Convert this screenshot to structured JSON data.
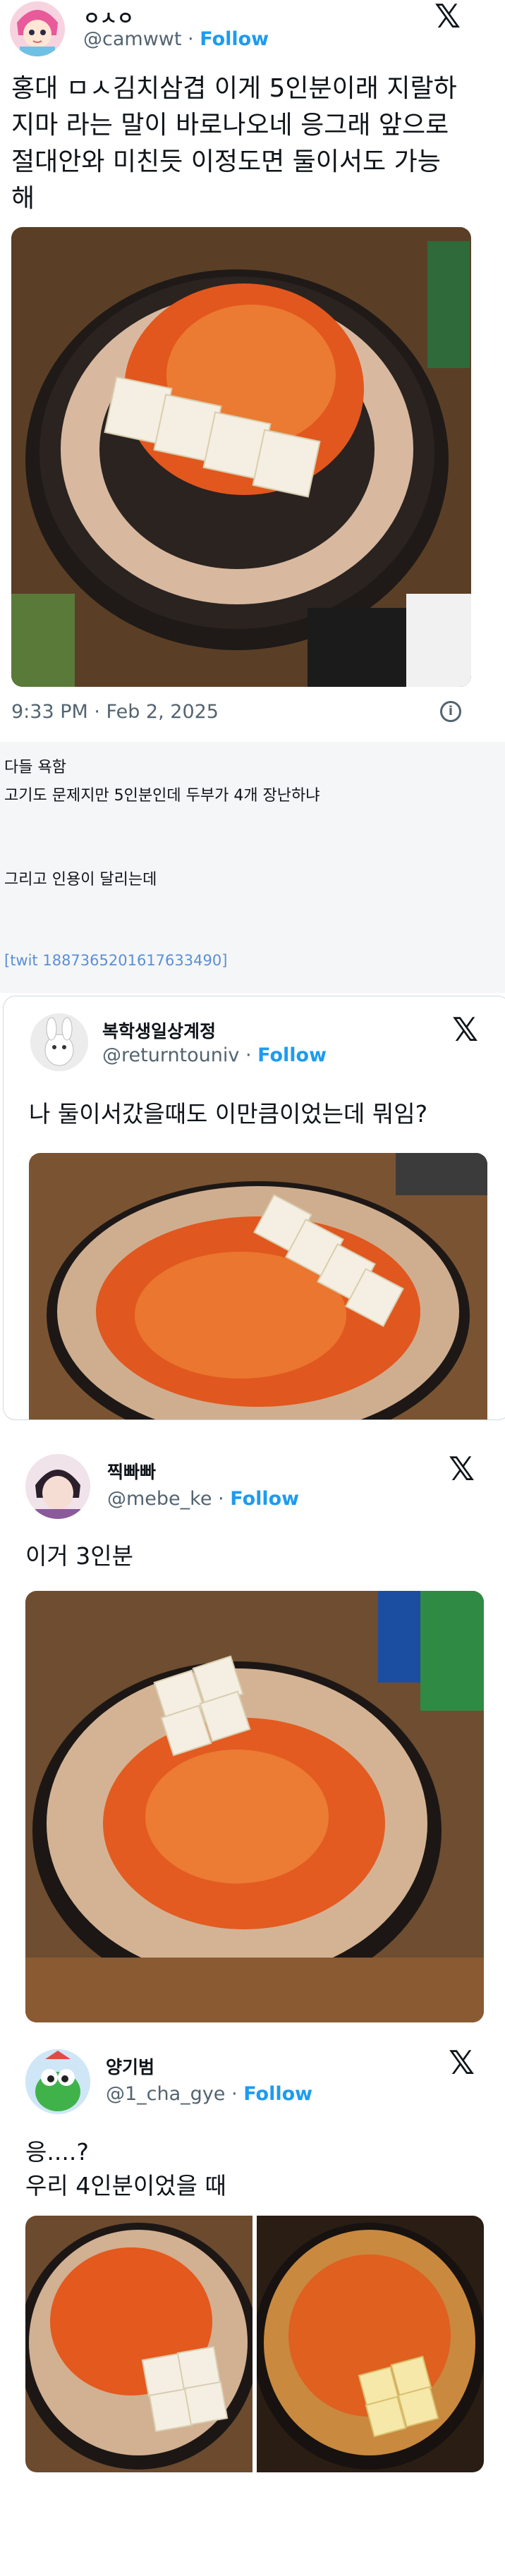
{
  "tweet1": {
    "name": "ㅇㅅㅇ",
    "handle": "@camwwt",
    "follow": "Follow",
    "text_lines": [
      "홍대 ㅁㅅ김치삼겹 이게 5인분이래 지랄하",
      "지마 라는 말이 바로나오네 응그래 앞으로",
      "절대안와 미친듯 이정도면 둘이서도 가능",
      "해"
    ],
    "time": "9:33 PM · Feb 2, 2025"
  },
  "post": {
    "lines": [
      "다들 욕함",
      "고기도 문제지만 5인분인데 두부가 4개 장난하냐",
      "그리고 인용이 달리는데"
    ],
    "twit_ref": "[twit 1887365201617633490]"
  },
  "tweet2": {
    "name": "복학생일상계정",
    "handle": "@returntouniv",
    "follow": "Follow",
    "text": "나 둘이서갔을때도 이만큼이었는데 뭐임?"
  },
  "tweet3": {
    "name": "찍빠빠",
    "handle": "@mebe_ke",
    "follow": "Follow",
    "text": "이거 3인분"
  },
  "tweet4": {
    "name": "양기범",
    "handle": "@1_cha_gye",
    "follow": "Follow",
    "text_lines": [
      "응....?",
      "우리 4인분이었을 때"
    ]
  },
  "colors": {
    "follow": "#1d9bf0",
    "muted": "#536471",
    "link": "#1d9bf0",
    "grey_panel": "#f5f6f7"
  }
}
